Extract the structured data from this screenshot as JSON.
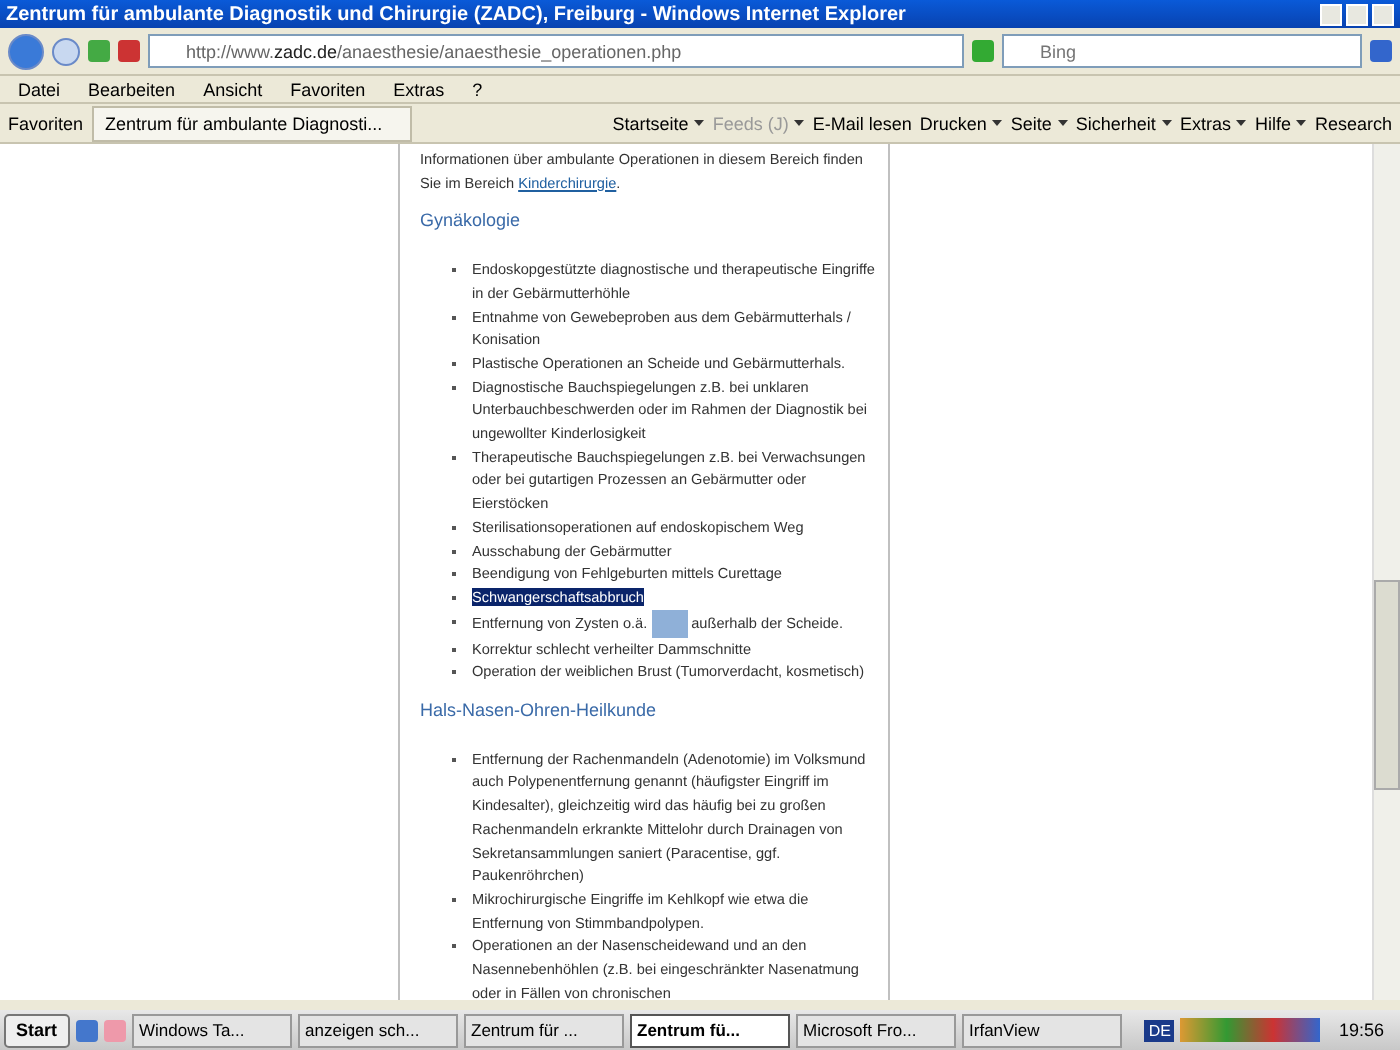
{
  "window": {
    "title": "Zentrum für ambulante Diagnostik und Chirurgie (ZADC), Freiburg - Windows Internet Explorer"
  },
  "address": {
    "prefix": "http://www.",
    "domain": "zadc.de",
    "path": "/anaesthesie/anaesthesie_operationen.php"
  },
  "search": {
    "placeholder": "Bing"
  },
  "menu": [
    "Datei",
    "Bearbeiten",
    "Ansicht",
    "Favoriten",
    "Extras",
    "?"
  ],
  "favorites": {
    "label": "Favoriten",
    "tab": "Zentrum für ambulante Diagnosti..."
  },
  "commands": [
    {
      "label": "Startseite",
      "disabled": false,
      "dropdown": true
    },
    {
      "label": "Feeds (J)",
      "disabled": true,
      "dropdown": true
    },
    {
      "label": "E-Mail lesen",
      "disabled": false,
      "dropdown": false
    },
    {
      "label": "Drucken",
      "disabled": false,
      "dropdown": true
    },
    {
      "label": "Seite",
      "disabled": false,
      "dropdown": true
    },
    {
      "label": "Sicherheit",
      "disabled": false,
      "dropdown": true
    },
    {
      "label": "Extras",
      "disabled": false,
      "dropdown": true
    },
    {
      "label": "Hilfe",
      "disabled": false,
      "dropdown": true
    },
    {
      "label": "Research",
      "disabled": false,
      "dropdown": false
    }
  ],
  "intro": {
    "text": "Informationen über ambulante Operationen in diesem Bereich finden Sie im Bereich",
    "link": "Kinderchirurgie",
    "end": "."
  },
  "sections": [
    {
      "heading": "Gynäkologie",
      "items": [
        {
          "text": "Endoskopgestützte diagnostische und therapeutische Eingriffe in der Gebärmutterhöhle",
          "highlighted": false
        },
        {
          "text": "Entnahme von Gewebeproben aus dem Gebärmutterhals / Konisation",
          "highlighted": false
        },
        {
          "text": "Plastische Operationen an Scheide und Gebärmutterhals.",
          "highlighted": false
        },
        {
          "text": "Diagnostische Bauchspiegelungen z.B. bei unklaren Unterbauchbeschwerden oder im Rahmen der Diagnostik bei ungewollter Kinderlosigkeit",
          "highlighted": false
        },
        {
          "text": "Therapeutische Bauchspiegelungen z.B. bei Verwachsungen oder bei gutartigen Prozessen an Gebärmutter oder Eierstöcken",
          "highlighted": false
        },
        {
          "text": "Sterilisationsoperationen auf endoskopischem Weg",
          "highlighted": false
        },
        {
          "text": "Ausschabung der Gebärmutter",
          "highlighted": false
        },
        {
          "text": "Beendigung von Fehlgeburten mittels Curettage",
          "highlighted": false
        },
        {
          "text": "Schwangerschaftsabbruch",
          "highlighted": true
        },
        {
          "text": "Entfernung von Zysten o.ä.",
          "after": "außerhalb der Scheide.",
          "highlighted": false
        },
        {
          "text": "Korrektur schlecht verheilter Dammschnitte",
          "highlighted": false
        },
        {
          "text": "Operation der weiblichen Brust (Tumorverdacht, kosmetisch)",
          "highlighted": false
        }
      ]
    },
    {
      "heading": "Hals-Nasen-Ohren-Heilkunde",
      "items": [
        {
          "text": "Entfernung der Rachenmandeln (Adenotomie) im Volksmund auch Polypenentfernung genannt (häufigster Eingriff im Kindesalter), gleichzeitig wird das häufig bei zu großen Rachenmandeln erkrankte Mittelohr durch Drainagen von Sekretansammlungen saniert (Paracentise, ggf. Paukenröhrchen)",
          "highlighted": false
        },
        {
          "text": "Mikrochirurgische Eingriffe im Kehlkopf wie etwa die Entfernung von Stimmbandpolypen.",
          "highlighted": false
        },
        {
          "text": "Operationen an der Nasenscheidewand und an den Nasennebenhöhlen (z.B. bei eingeschränkter Nasenatmung oder in Fällen von chronischen",
          "highlighted": false
        }
      ]
    }
  ],
  "taskbar": {
    "start": "Start",
    "tasks": [
      {
        "label": "Windows Ta...",
        "selected": false
      },
      {
        "label": "anzeigen sch...",
        "selected": false
      },
      {
        "label": "Zentrum für ...",
        "selected": false
      },
      {
        "label": "Zentrum fü...",
        "selected": true
      },
      {
        "label": "Microsoft Fro...",
        "selected": false
      },
      {
        "label": "IrfanView",
        "selected": false
      }
    ],
    "language": "DE",
    "clock": "19:56"
  }
}
